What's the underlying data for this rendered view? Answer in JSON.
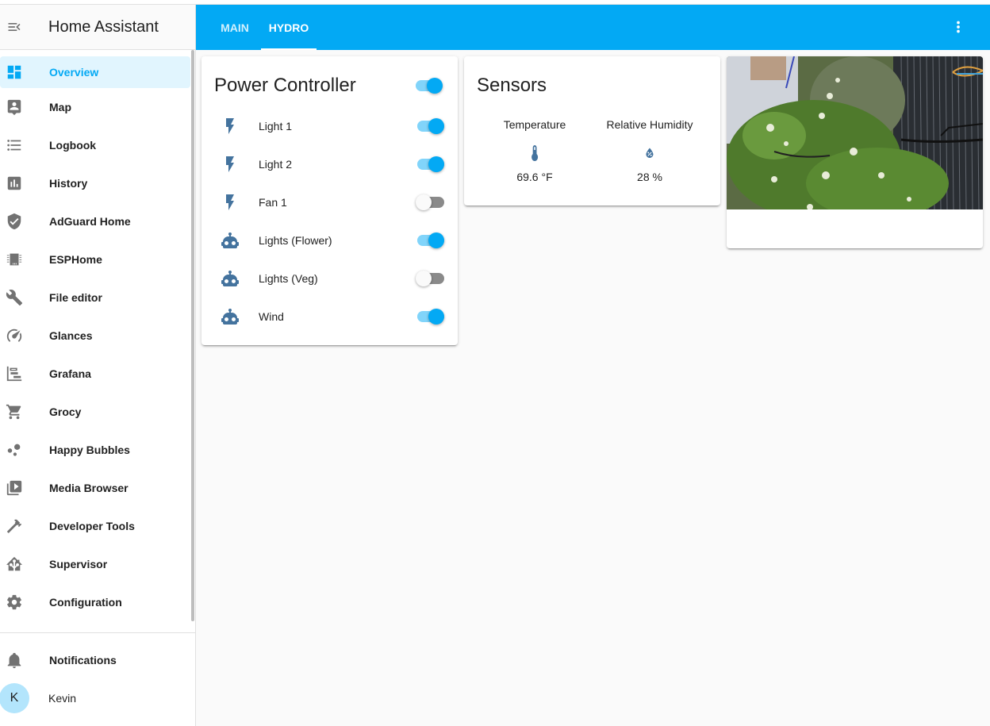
{
  "app": {
    "title": "Home Assistant"
  },
  "sidebar": {
    "items": [
      {
        "label": "Overview",
        "icon": "view-dashboard-icon",
        "active": true
      },
      {
        "label": "Map",
        "icon": "map-account-icon"
      },
      {
        "label": "Logbook",
        "icon": "format-list-bulleted-icon"
      },
      {
        "label": "History",
        "icon": "chart-box-icon"
      },
      {
        "label": "AdGuard Home",
        "icon": "shield-check-icon"
      },
      {
        "label": "ESPHome",
        "icon": "chip-icon"
      },
      {
        "label": "File editor",
        "icon": "wrench-icon"
      },
      {
        "label": "Glances",
        "icon": "speedometer-icon"
      },
      {
        "label": "Grafana",
        "icon": "chart-timeline-icon"
      },
      {
        "label": "Grocy",
        "icon": "cart-icon"
      },
      {
        "label": "Happy Bubbles",
        "icon": "bubbles-icon"
      },
      {
        "label": "Media Browser",
        "icon": "play-box-multiple-icon"
      },
      {
        "label": "Developer Tools",
        "icon": "hammer-icon"
      },
      {
        "label": "Supervisor",
        "icon": "home-assistant-icon"
      },
      {
        "label": "Configuration",
        "icon": "cog-icon"
      }
    ],
    "notifications_label": "Notifications",
    "user": {
      "name": "Kevin",
      "initial": "K"
    }
  },
  "appbar": {
    "tabs": [
      {
        "label": "MAIN",
        "active": false
      },
      {
        "label": "HYDRO",
        "active": true
      }
    ],
    "menu_icon": "dots-vertical-icon"
  },
  "power_controller": {
    "title": "Power Controller",
    "header_toggle_on": true,
    "entities": [
      {
        "name": "Light 1",
        "icon": "flash-icon",
        "on": true
      },
      {
        "name": "Light 2",
        "icon": "flash-icon",
        "on": true
      },
      {
        "name": "Fan 1",
        "icon": "flash-icon",
        "on": false
      },
      {
        "name": "Lights (Flower)",
        "icon": "robot-icon",
        "on": true
      },
      {
        "name": "Lights (Veg)",
        "icon": "robot-icon",
        "on": false
      },
      {
        "name": "Wind",
        "icon": "robot-icon",
        "on": true
      }
    ]
  },
  "sensors": {
    "title": "Sensors",
    "items": [
      {
        "name": "Temperature",
        "icon": "thermometer-icon",
        "value": "69.6 °F"
      },
      {
        "name": "Relative Humidity",
        "icon": "water-percent-icon",
        "value": "28 %"
      }
    ]
  },
  "camera": {
    "description": "Camera feed of hydroponic pepper plants"
  },
  "colors": {
    "primary": "#03a9f4",
    "icon_state": "#44739e",
    "sidebar_icon": "#727272"
  }
}
